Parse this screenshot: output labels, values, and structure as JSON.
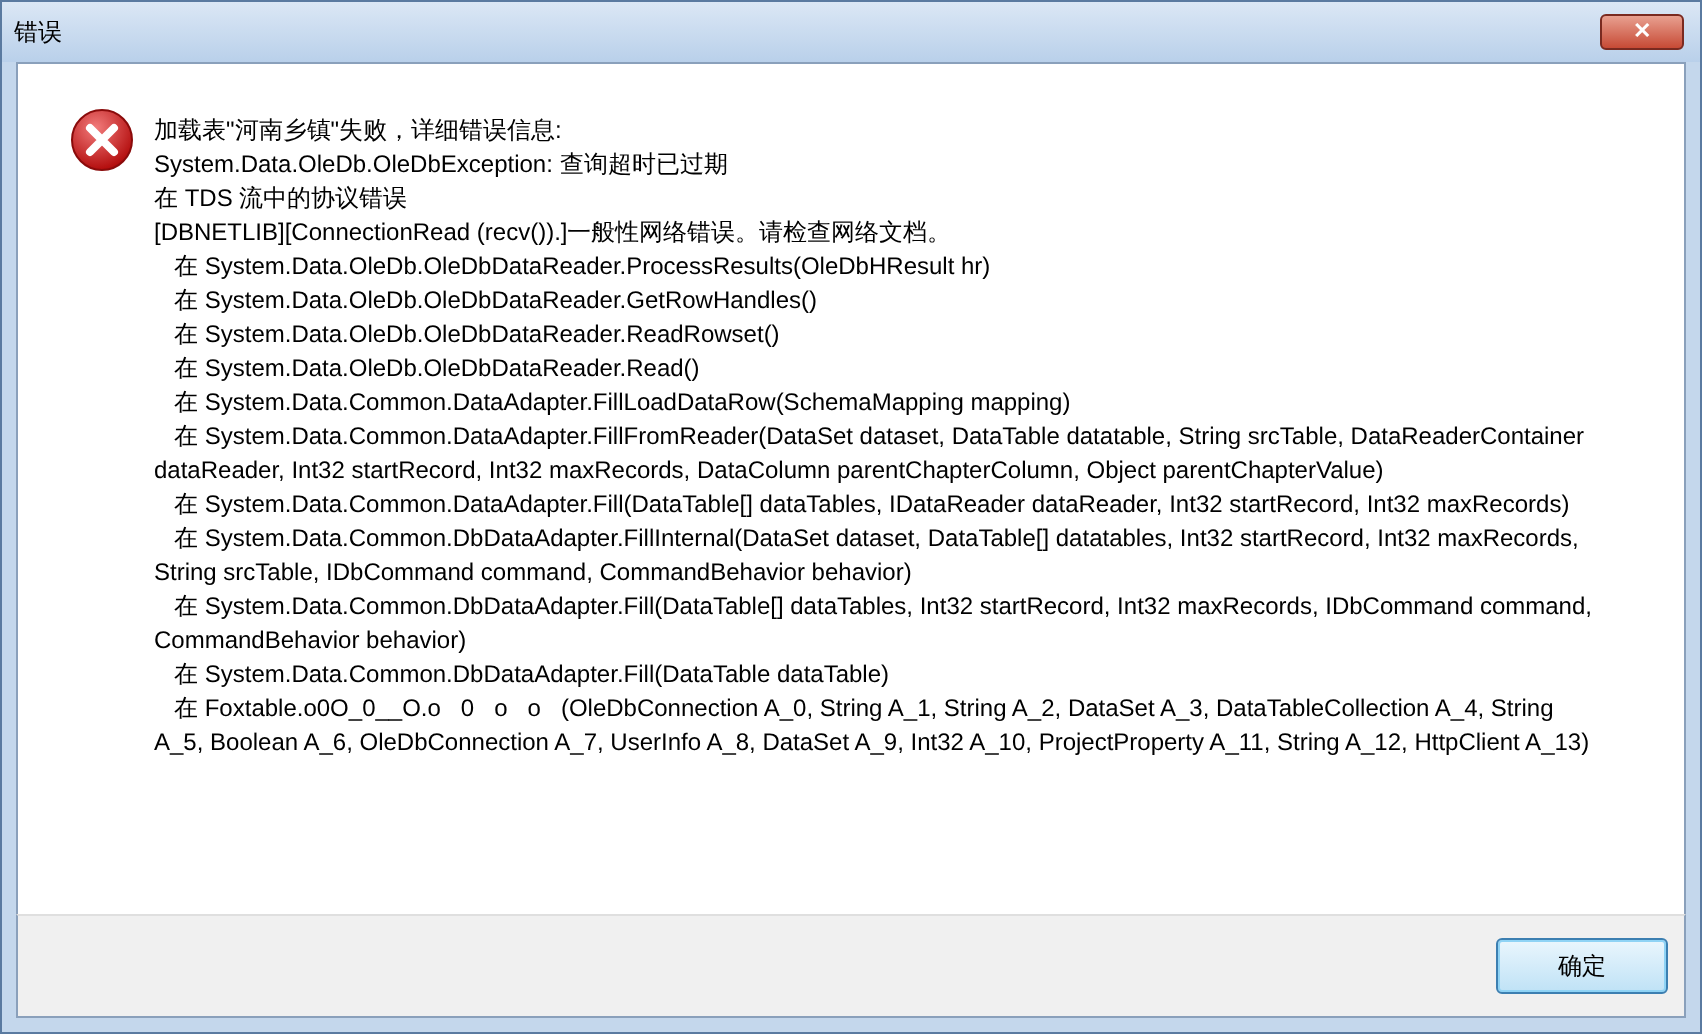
{
  "window": {
    "title": "错误",
    "close_label": "✕"
  },
  "message": {
    "lines": [
      "加载表\"河南乡镇\"失败，详细错误信息:",
      "System.Data.OleDb.OleDbException: 查询超时已过期",
      "在 TDS 流中的协议错误",
      "[DBNETLIB][ConnectionRead (recv()).]一般性网络错误。请检查网络文档。",
      "   在 System.Data.OleDb.OleDbDataReader.ProcessResults(OleDbHResult hr)",
      "   在 System.Data.OleDb.OleDbDataReader.GetRowHandles()",
      "   在 System.Data.OleDb.OleDbDataReader.ReadRowset()",
      "   在 System.Data.OleDb.OleDbDataReader.Read()",
      "   在 System.Data.Common.DataAdapter.FillLoadDataRow(SchemaMapping mapping)",
      "   在 System.Data.Common.DataAdapter.FillFromReader(DataSet dataset, DataTable datatable, String srcTable, DataReaderContainer dataReader, Int32 startRecord, Int32 maxRecords, DataColumn parentChapterColumn, Object parentChapterValue)",
      "   在 System.Data.Common.DataAdapter.Fill(DataTable[] dataTables, IDataReader dataReader, Int32 startRecord, Int32 maxRecords)",
      "   在 System.Data.Common.DbDataAdapter.FillInternal(DataSet dataset, DataTable[] datatables, Int32 startRecord, Int32 maxRecords, String srcTable, IDbCommand command, CommandBehavior behavior)",
      "   在 System.Data.Common.DbDataAdapter.Fill(DataTable[] dataTables, Int32 startRecord, Int32 maxRecords, IDbCommand command, CommandBehavior behavior)",
      "   在 System.Data.Common.DbDataAdapter.Fill(DataTable dataTable)",
      "   在 Foxtable.o0O_0__O.o   0   o   o   (OleDbConnection A_0, String A_1, String A_2, DataSet A_3, DataTableCollection A_4, String A_5, Boolean A_6, OleDbConnection A_7, UserInfo A_8, DataSet A_9, Int32 A_10, ProjectProperty A_11, String A_12, HttpClient A_13)"
    ]
  },
  "buttons": [
    "确定"
  ]
}
